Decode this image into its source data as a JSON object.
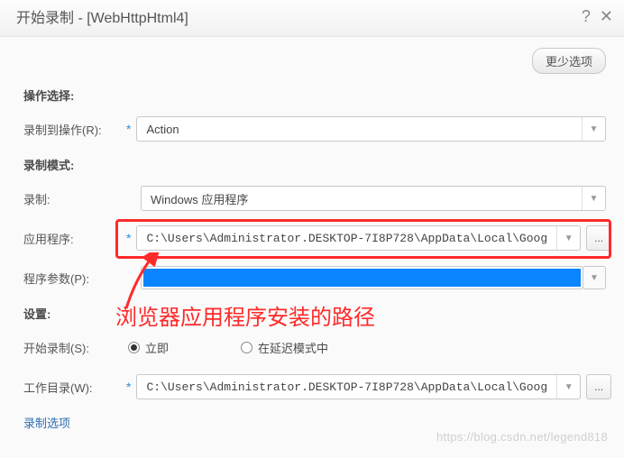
{
  "titlebar": {
    "title": "开始录制 - [WebHttpHtml4]"
  },
  "buttons": {
    "more_options": "更少选项",
    "browse": "..."
  },
  "sections": {
    "action_select": "操作选择:",
    "record_mode": "录制模式:",
    "settings": "设置:"
  },
  "labels": {
    "record_to_action": "录制到操作(R):",
    "record": "录制:",
    "application": "应用程序:",
    "program_args": "程序参数(P):",
    "start_record": "开始录制(S):",
    "working_dir": "工作目录(W):"
  },
  "values": {
    "action_combo": "Action",
    "record_combo": "Windows 应用程序",
    "app_path": "C:\\Users\\Administrator.DESKTOP-7I8P728\\AppData\\Local\\Goog",
    "working_dir": "C:\\Users\\Administrator.DESKTOP-7I8P728\\AppData\\Local\\Goog"
  },
  "radios": {
    "immediate": "立即",
    "delayed": "在延迟模式中"
  },
  "link": {
    "record_options": "录制选项"
  },
  "annotation": "浏览器应用程序安装的路径",
  "watermark": "https://blog.csdn.net/legend818"
}
